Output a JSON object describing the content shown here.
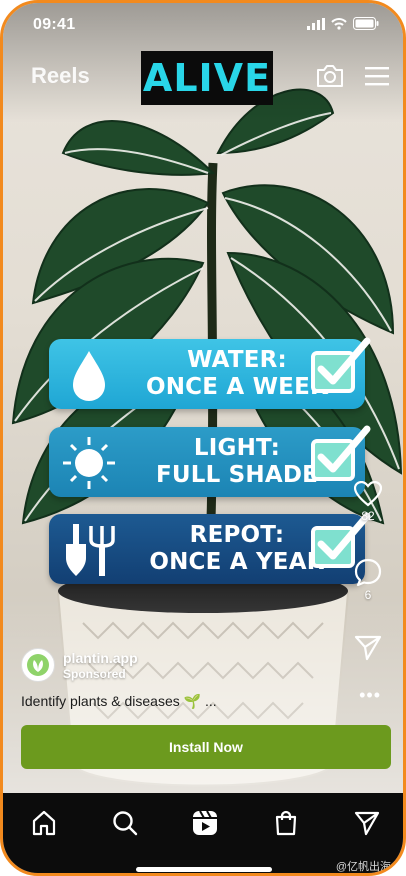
{
  "status_bar": {
    "time": "09:41"
  },
  "header": {
    "title": "Reels",
    "banner_text": "ALIVE"
  },
  "care_cards": [
    {
      "line1": "WATER:",
      "line2": "ONCE A WEEK",
      "icon": "water-drop-icon"
    },
    {
      "line1": "LIGHT:",
      "line2": "FULL SHADE",
      "icon": "sun-icon"
    },
    {
      "line1": "REPOT:",
      "line2": "ONCE A YEAR",
      "icon": "garden-tools-icon"
    }
  ],
  "side_actions": {
    "likes_count": "82",
    "comments_count": "6"
  },
  "sponsor": {
    "name": "plantin.app",
    "label": "Sponsored",
    "caption": "Identify plants & diseases 🌱 ..."
  },
  "cta": {
    "install_label": "Install Now"
  },
  "watermark": "@亿帆出海",
  "colors": {
    "brand_green": "#6c9a1e",
    "banner_cyan": "#29d6e8",
    "frame_orange": "#f28a1e"
  }
}
